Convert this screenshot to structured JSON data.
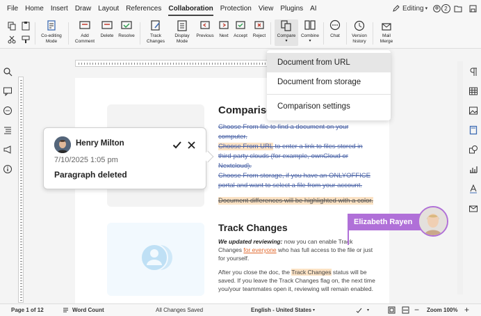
{
  "menu": {
    "tabs": [
      "File",
      "Home",
      "Insert",
      "Draw",
      "Layout",
      "References",
      "Collaboration",
      "Protection",
      "View",
      "Plugins",
      "AI"
    ],
    "active": "Collaboration",
    "editing_label": "Editing",
    "users_count": "2"
  },
  "toolbar": {
    "coediting": "Co-editing\nMode",
    "add_comment": "Add\nComment",
    "delete": "Delete",
    "resolve": "Resolve",
    "track_changes": "Track\nChanges",
    "display_mode": "Display\nMode",
    "previous": "Previous",
    "next": "Next",
    "accept": "Accept",
    "reject": "Reject",
    "compare": "Compare",
    "combine": "Combine",
    "chat": "Chat",
    "version_history": "Version\nhistory",
    "mail_merge": "Mail\nMerge"
  },
  "compare_menu": {
    "items": [
      "Document from URL",
      "Document from storage",
      "Comparison settings"
    ]
  },
  "document": {
    "heading1": "Comparison",
    "p1": "Choose From file to find a document on your computer.",
    "p2_strike_hl": "Choose From URL",
    "p2_rest": " to enter a link to files stored in third-party clouds (for example, ownCloud or Nextcloud).",
    "p3": "Choose From storage, if you have an ONLYOFFICE portal and want to select a file from your account.",
    "p4": "Document differences will be highlighted with a color.",
    "heading2": "Track Changes",
    "tc_bold": "We updated reviewing:",
    "tc_text1": " now you can enable Track Changes",
    "tc_ins": "for everyone",
    "tc_text2": " who has full access to the file or just for yourself.",
    "tc_p2a": "After you close the doc, the ",
    "tc_p2hl": "Track Changes",
    "tc_p2b": " status will be saved. If you leave the Track Changes flag on, the next time you/your teammates open it, reviewing will remain enabled."
  },
  "comment": {
    "author": "Henry Milton",
    "date": "7/10/2025 1:05 pm",
    "text": "Paragraph deleted"
  },
  "collaborator": {
    "name": "Elizabeth Rayen",
    "color": "#b070d8"
  },
  "statusbar": {
    "page": "Page 1 of 12",
    "word_count": "Word Count",
    "saved": "All Changes Saved",
    "language": "English - United States",
    "zoom": "Zoom 100%"
  },
  "colors": {
    "strike": "#4a63a6",
    "highlight": "#fbe2c4",
    "insert": "#e0672b"
  }
}
